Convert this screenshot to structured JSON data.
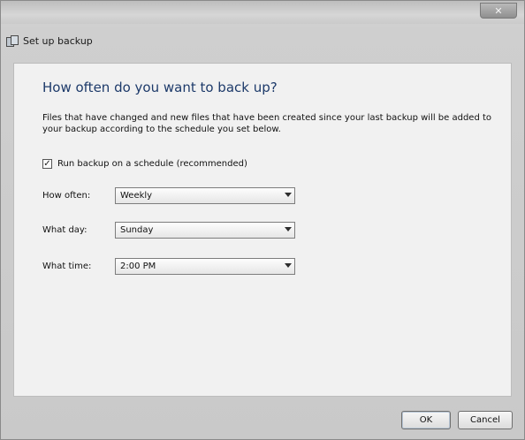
{
  "window": {
    "title": "Set up backup",
    "close_label": "✕"
  },
  "page": {
    "heading": "How often do you want to back up?",
    "description": "Files that have changed and new files that have been created since your last backup will be added to your backup according to the schedule you set below."
  },
  "schedule": {
    "checkbox_label": "Run backup on a schedule (recommended)",
    "checkbox_checked": true,
    "checkbox_mark": "✓",
    "how_often": {
      "label": "How often:",
      "value": "Weekly"
    },
    "what_day": {
      "label": "What day:",
      "value": "Sunday"
    },
    "what_time": {
      "label": "What time:",
      "value": "2:00 PM"
    }
  },
  "buttons": {
    "ok_label": "OK",
    "cancel_label": "Cancel"
  }
}
